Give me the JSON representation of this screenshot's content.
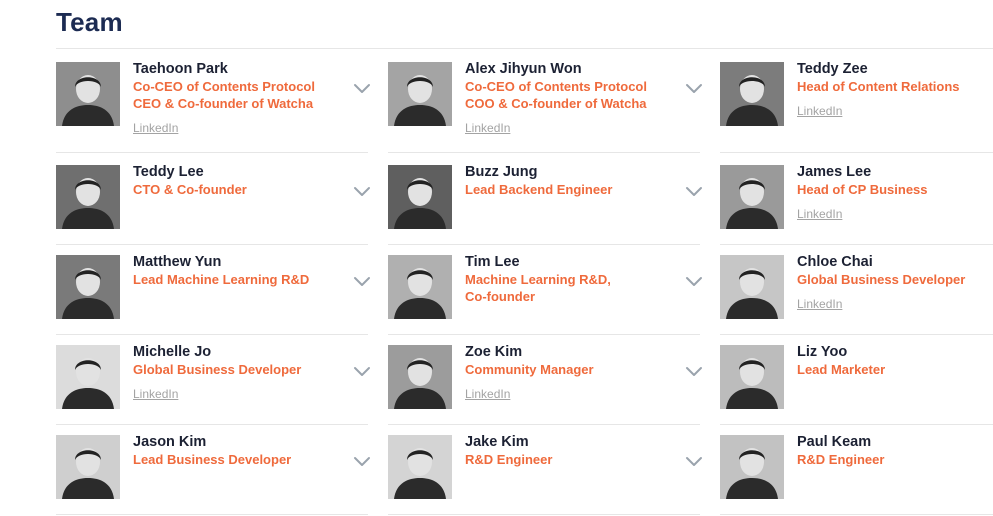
{
  "section": {
    "title": "Team"
  },
  "members": [
    {
      "name": "Taehoon Park",
      "roles": [
        "Co-CEO of Contents Protocol",
        "CEO & Co-founder of Watcha"
      ],
      "link": "LinkedIn",
      "photo_tone": "#8e8e8e"
    },
    {
      "name": "Alex Jihyun Won",
      "roles": [
        "Co-CEO of Contents Protocol",
        "COO & Co-founder of Watcha"
      ],
      "link": "LinkedIn",
      "photo_tone": "#a4a4a4"
    },
    {
      "name": "Teddy Zee",
      "roles": [
        "Head of Content Relations"
      ],
      "link": "LinkedIn",
      "photo_tone": "#7c7c7c"
    },
    {
      "name": "Teddy Lee",
      "roles": [
        "CTO & Co-founder"
      ],
      "link": "",
      "photo_tone": "#6f6f6f"
    },
    {
      "name": "Buzz Jung",
      "roles": [
        "Lead Backend Engineer"
      ],
      "link": "",
      "photo_tone": "#5f5f5f"
    },
    {
      "name": "James Lee",
      "roles": [
        "Head of CP Business"
      ],
      "link": "LinkedIn",
      "photo_tone": "#9a9a9a"
    },
    {
      "name": "Matthew Yun",
      "roles": [
        "Lead Machine Learning R&D"
      ],
      "link": "",
      "photo_tone": "#7a7a7a"
    },
    {
      "name": "Tim Lee",
      "roles": [
        "Machine Learning R&D,",
        "Co-founder"
      ],
      "link": "",
      "photo_tone": "#b0b0b0"
    },
    {
      "name": "Chloe Chai",
      "roles": [
        "Global Business Developer"
      ],
      "link": "LinkedIn",
      "photo_tone": "#c6c6c6"
    },
    {
      "name": "Michelle Jo",
      "roles": [
        "Global Business Developer"
      ],
      "link": "LinkedIn",
      "photo_tone": "#dcdcdc"
    },
    {
      "name": "Zoe Kim",
      "roles": [
        "Community Manager"
      ],
      "link": "LinkedIn",
      "photo_tone": "#9c9c9c"
    },
    {
      "name": "Liz Yoo",
      "roles": [
        "Lead Marketer"
      ],
      "link": "",
      "photo_tone": "#bcbcbc"
    },
    {
      "name": "Jason Kim",
      "roles": [
        "Lead Business Developer"
      ],
      "link": "",
      "photo_tone": "#cfcfcf"
    },
    {
      "name": "Jake Kim",
      "roles": [
        "R&D Engineer"
      ],
      "link": "",
      "photo_tone": "#d4d4d4"
    },
    {
      "name": "Paul Keam",
      "roles": [
        "R&D Engineer"
      ],
      "link": "",
      "photo_tone": "#c2c2c2"
    }
  ],
  "colors": {
    "title": "#1c2b52",
    "name": "#1c2133",
    "role": "#ef6a3c",
    "link": "#a3a3a3",
    "chevron": "#9aa3ad",
    "divider": "#e6e6e6"
  },
  "icons": {
    "expand": "chevron-down-icon"
  }
}
